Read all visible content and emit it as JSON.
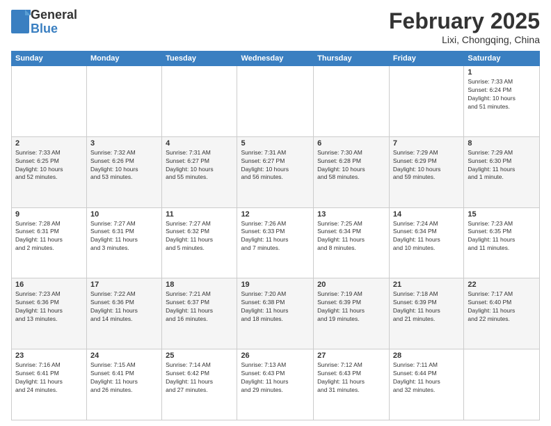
{
  "header": {
    "logo_general": "General",
    "logo_blue": "Blue",
    "month_title": "February 2025",
    "location": "Lixi, Chongqing, China"
  },
  "days_of_week": [
    "Sunday",
    "Monday",
    "Tuesday",
    "Wednesday",
    "Thursday",
    "Friday",
    "Saturday"
  ],
  "weeks": [
    {
      "days": [
        {
          "num": "",
          "info": ""
        },
        {
          "num": "",
          "info": ""
        },
        {
          "num": "",
          "info": ""
        },
        {
          "num": "",
          "info": ""
        },
        {
          "num": "",
          "info": ""
        },
        {
          "num": "",
          "info": ""
        },
        {
          "num": "1",
          "info": "Sunrise: 7:33 AM\nSunset: 6:24 PM\nDaylight: 10 hours\nand 51 minutes."
        }
      ]
    },
    {
      "days": [
        {
          "num": "2",
          "info": "Sunrise: 7:33 AM\nSunset: 6:25 PM\nDaylight: 10 hours\nand 52 minutes."
        },
        {
          "num": "3",
          "info": "Sunrise: 7:32 AM\nSunset: 6:26 PM\nDaylight: 10 hours\nand 53 minutes."
        },
        {
          "num": "4",
          "info": "Sunrise: 7:31 AM\nSunset: 6:27 PM\nDaylight: 10 hours\nand 55 minutes."
        },
        {
          "num": "5",
          "info": "Sunrise: 7:31 AM\nSunset: 6:27 PM\nDaylight: 10 hours\nand 56 minutes."
        },
        {
          "num": "6",
          "info": "Sunrise: 7:30 AM\nSunset: 6:28 PM\nDaylight: 10 hours\nand 58 minutes."
        },
        {
          "num": "7",
          "info": "Sunrise: 7:29 AM\nSunset: 6:29 PM\nDaylight: 10 hours\nand 59 minutes."
        },
        {
          "num": "8",
          "info": "Sunrise: 7:29 AM\nSunset: 6:30 PM\nDaylight: 11 hours\nand 1 minute."
        }
      ]
    },
    {
      "days": [
        {
          "num": "9",
          "info": "Sunrise: 7:28 AM\nSunset: 6:31 PM\nDaylight: 11 hours\nand 2 minutes."
        },
        {
          "num": "10",
          "info": "Sunrise: 7:27 AM\nSunset: 6:31 PM\nDaylight: 11 hours\nand 3 minutes."
        },
        {
          "num": "11",
          "info": "Sunrise: 7:27 AM\nSunset: 6:32 PM\nDaylight: 11 hours\nand 5 minutes."
        },
        {
          "num": "12",
          "info": "Sunrise: 7:26 AM\nSunset: 6:33 PM\nDaylight: 11 hours\nand 7 minutes."
        },
        {
          "num": "13",
          "info": "Sunrise: 7:25 AM\nSunset: 6:34 PM\nDaylight: 11 hours\nand 8 minutes."
        },
        {
          "num": "14",
          "info": "Sunrise: 7:24 AM\nSunset: 6:34 PM\nDaylight: 11 hours\nand 10 minutes."
        },
        {
          "num": "15",
          "info": "Sunrise: 7:23 AM\nSunset: 6:35 PM\nDaylight: 11 hours\nand 11 minutes."
        }
      ]
    },
    {
      "days": [
        {
          "num": "16",
          "info": "Sunrise: 7:23 AM\nSunset: 6:36 PM\nDaylight: 11 hours\nand 13 minutes."
        },
        {
          "num": "17",
          "info": "Sunrise: 7:22 AM\nSunset: 6:36 PM\nDaylight: 11 hours\nand 14 minutes."
        },
        {
          "num": "18",
          "info": "Sunrise: 7:21 AM\nSunset: 6:37 PM\nDaylight: 11 hours\nand 16 minutes."
        },
        {
          "num": "19",
          "info": "Sunrise: 7:20 AM\nSunset: 6:38 PM\nDaylight: 11 hours\nand 18 minutes."
        },
        {
          "num": "20",
          "info": "Sunrise: 7:19 AM\nSunset: 6:39 PM\nDaylight: 11 hours\nand 19 minutes."
        },
        {
          "num": "21",
          "info": "Sunrise: 7:18 AM\nSunset: 6:39 PM\nDaylight: 11 hours\nand 21 minutes."
        },
        {
          "num": "22",
          "info": "Sunrise: 7:17 AM\nSunset: 6:40 PM\nDaylight: 11 hours\nand 22 minutes."
        }
      ]
    },
    {
      "days": [
        {
          "num": "23",
          "info": "Sunrise: 7:16 AM\nSunset: 6:41 PM\nDaylight: 11 hours\nand 24 minutes."
        },
        {
          "num": "24",
          "info": "Sunrise: 7:15 AM\nSunset: 6:41 PM\nDaylight: 11 hours\nand 26 minutes."
        },
        {
          "num": "25",
          "info": "Sunrise: 7:14 AM\nSunset: 6:42 PM\nDaylight: 11 hours\nand 27 minutes."
        },
        {
          "num": "26",
          "info": "Sunrise: 7:13 AM\nSunset: 6:43 PM\nDaylight: 11 hours\nand 29 minutes."
        },
        {
          "num": "27",
          "info": "Sunrise: 7:12 AM\nSunset: 6:43 PM\nDaylight: 11 hours\nand 31 minutes."
        },
        {
          "num": "28",
          "info": "Sunrise: 7:11 AM\nSunset: 6:44 PM\nDaylight: 11 hours\nand 32 minutes."
        },
        {
          "num": "",
          "info": ""
        }
      ]
    }
  ]
}
